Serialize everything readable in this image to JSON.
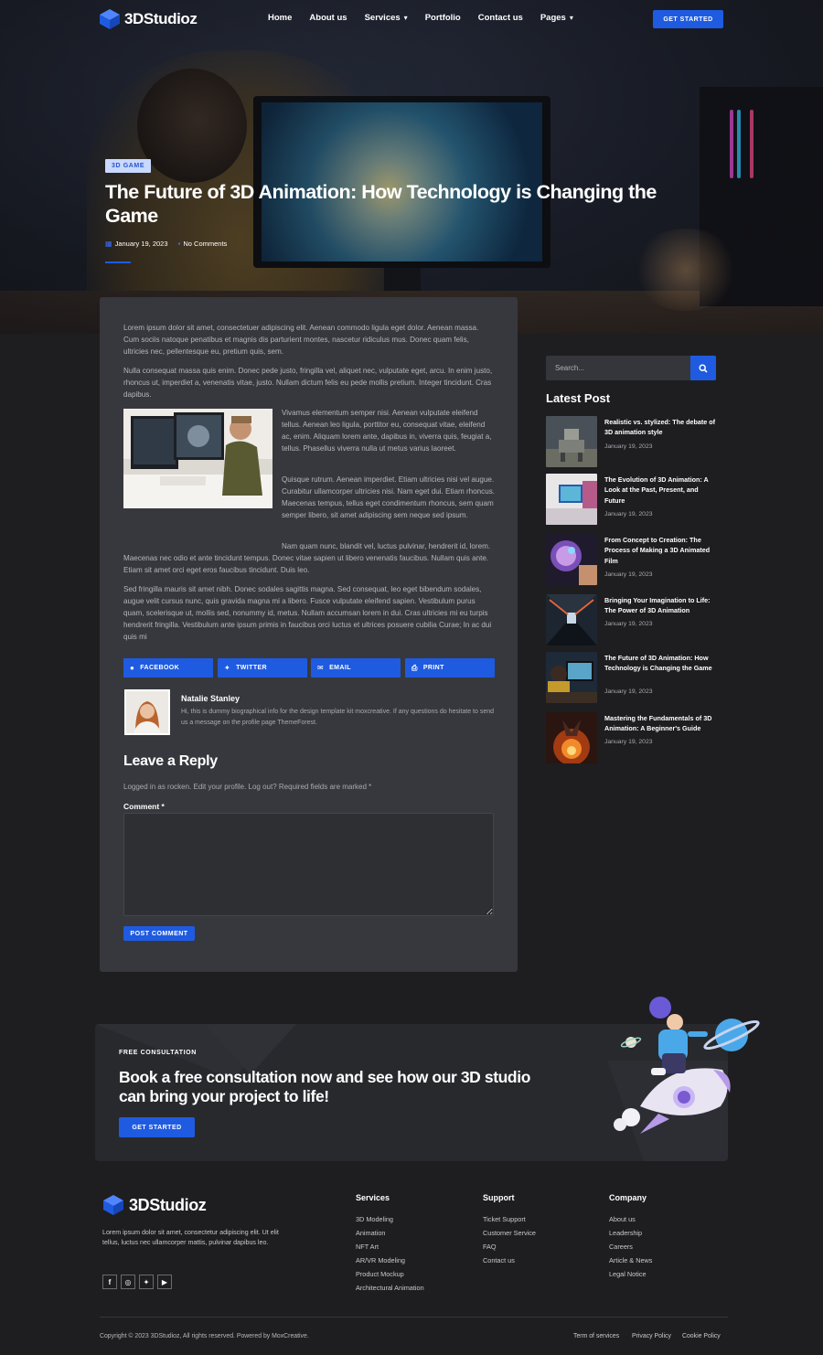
{
  "header": {
    "logo_text": "3DStudioz",
    "nav": [
      {
        "label": "Home"
      },
      {
        "label": "About us"
      },
      {
        "label": "Services",
        "dropdown": true
      },
      {
        "label": "Portfolio"
      },
      {
        "label": "Contact us"
      },
      {
        "label": "Pages",
        "dropdown": true
      }
    ],
    "cta_label": "GET STARTED"
  },
  "post": {
    "category": "3D GAME",
    "title": "The Future of 3D Animation: How Technology is Changing the Game",
    "date": "January 19, 2023",
    "comments": "No Comments",
    "paragraphs": [
      "Lorem ipsum dolor sit amet, consectetuer adipiscing elit. Aenean commodo ligula eget dolor. Aenean massa. Cum sociis natoque penatibus et magnis dis parturient montes, nascetur ridiculus mus. Donec quam felis, ultricies nec, pellentesque eu, pretium quis, sem.",
      "Nulla consequat massa quis enim. Donec pede justo, fringilla vel, aliquet nec, vulputate eget, arcu. In enim justo, rhoncus ut, imperdiet a, venenatis vitae, justo. Nullam dictum felis eu pede mollis pretium. Integer tincidunt. Cras dapibus.",
      "Vivamus elementum semper nisi. Aenean vulputate eleifend tellus. Aenean leo ligula, porttitor eu, consequat vitae, eleifend ac, enim. Aliquam lorem ante, dapibus in, viverra quis, feugiat a, tellus. Phasellus viverra nulla ut metus varius laoreet.",
      "Quisque rutrum. Aenean imperdiet. Etiam ultricies nisi vel augue. Curabitur ullamcorper ultricies nisi. Nam eget dui. Etiam rhoncus. Maecenas tempus, tellus eget condimentum rhoncus, sem quam semper libero, sit amet adipiscing sem neque sed ipsum.",
      "Nam quam nunc, blandit vel, luctus pulvinar, hendrerit id, lorem. Maecenas nec odio et ante tincidunt tempus. Donec vitae sapien ut libero venenatis faucibus. Nullam quis ante. Etiam sit amet orci eget eros faucibus tincidunt. Duis leo.",
      "Sed fringilla mauris sit amet nibh. Donec sodales sagittis magna. Sed consequat, leo eget bibendum sodales, augue velit cursus nunc, quis gravida magna mi a libero. Fusce vulputate eleifend sapien. Vestibulum purus quam, scelerisque ut, mollis sed, nonummy id, metus. Nullam accumsan lorem in dui. Cras ultricies mi eu turpis hendrerit fringilla. Vestibulum ante ipsum primis in faucibus orci luctus et ultrices posuere cubilia Curae; In ac dui quis mi"
    ],
    "share": [
      "FACEBOOK",
      "TWITTER",
      "EMAIL",
      "PRINT"
    ],
    "author": {
      "name": "Natalie Stanley",
      "bio": "Hi, this is dummy biographical info for the design template kit moxcreative. If any questions do hesitate to send us a message on the profile page ThemeForest."
    }
  },
  "reply": {
    "title": "Leave a Reply",
    "logged_in": "Logged in as rocken. Edit your profile. Log out? Required fields are marked *",
    "comment_label": "Comment *",
    "comment_value": "",
    "submit_label": "POST COMMENT"
  },
  "sidebar": {
    "search_placeholder": "Search...",
    "latest_title": "Latest Post",
    "posts": [
      {
        "title": "Realistic vs. stylized: The debate of 3D animation style",
        "date": "January 19, 2023"
      },
      {
        "title": "The Evolution of 3D Animation: A Look at the Past, Present, and Future",
        "date": "January 19, 2023"
      },
      {
        "title": "From Concept to Creation: The Process of Making a 3D Animated Film",
        "date": "January 19, 2023"
      },
      {
        "title": "Bringing Your Imagination to Life: The Power of 3D Animation",
        "date": "January 19, 2023"
      },
      {
        "title": "The Future of 3D Animation: How Technology is Changing the Game",
        "date": "January 19, 2023"
      },
      {
        "title": "Mastering the Fundamentals of 3D Animation: A Beginner's Guide",
        "date": "January 19, 2023"
      }
    ]
  },
  "cta": {
    "kicker": "FREE CONSULTATION",
    "title": "Book a free consultation now and see how our 3D studio can bring your project to life!",
    "button": "GET STARTED"
  },
  "footer": {
    "logo_text": "3DStudioz",
    "description": "Lorem ipsum dolor sit amet, consectetur adipiscing elit. Ut elit tellus, luctus nec ullamcorper mattis, pulvinar dapibus leo.",
    "socials": [
      "facebook-icon",
      "instagram-icon",
      "twitter-icon",
      "youtube-icon"
    ],
    "columns": [
      {
        "title": "Services",
        "items": [
          "3D Modeling",
          "Animation",
          "NFT Art",
          "AR/VR Modeling",
          "Product Mockup",
          "Architectural Animation"
        ]
      },
      {
        "title": "Support",
        "items": [
          "Ticket Support",
          "Customer Service",
          "FAQ",
          "Contact us"
        ]
      },
      {
        "title": "Company",
        "items": [
          "About us",
          "Leadership",
          "Careers",
          "Article & News",
          "Legal Notice"
        ]
      }
    ],
    "copyright": "Copyright © 2023 3DStudioz, All rights reserved. Powered by MoxCreative.",
    "legal_links": [
      "Term of services",
      "Privacy Policy",
      "Cookie Policy"
    ]
  },
  "colors": {
    "accent": "#1f5be0",
    "background": "#1e1e20",
    "card": "#37383d",
    "badge_bg": "#c9d9ff"
  }
}
